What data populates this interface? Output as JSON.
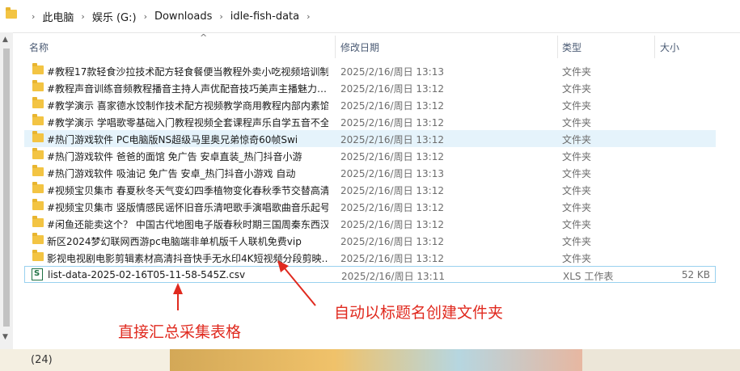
{
  "breadcrumb": [
    "此电脑",
    "娱乐 (G:)",
    "Downloads",
    "idle-fish-data"
  ],
  "columns": {
    "name": "名称",
    "modified": "修改日期",
    "type": "类型",
    "size": "大小"
  },
  "rows": [
    {
      "name": "#教程17款轻食沙拉技术配方轻食餐便当教程外卖小吃视频培训制",
      "date": "2025/2/16/周日 13:13",
      "type": "文件夹",
      "size": ""
    },
    {
      "name": "#教程声音训练音频教程播音主持人声优配音技巧美声主播魅力…",
      "date": "2025/2/16/周日 13:12",
      "type": "文件夹",
      "size": ""
    },
    {
      "name": "#教学演示 喜家德水饺制作技术配方视频教学商用教程内部内素馅",
      "date": "2025/2/16/周日 13:12",
      "type": "文件夹",
      "size": ""
    },
    {
      "name": "#教学演示 学唱歌零基础入门教程视频全套课程声乐自学五音不全",
      "date": "2025/2/16/周日 13:12",
      "type": "文件夹",
      "size": ""
    },
    {
      "name": "#热门游戏软件 PC电脑版NS超级马里奥兄弟惊奇60帧Swi",
      "date": "2025/2/16/周日 13:12",
      "type": "文件夹",
      "size": ""
    },
    {
      "name": "#热门游戏软件 爸爸的面馆  免广告 安卓直装_热门抖音小游",
      "date": "2025/2/16/周日 13:12",
      "type": "文件夹",
      "size": ""
    },
    {
      "name": "#热门游戏软件 吸油记 免广告 安卓_热门抖音小游戏  自动",
      "date": "2025/2/16/周日 13:13",
      "type": "文件夹",
      "size": ""
    },
    {
      "name": "#视频宝贝集市 春夏秋冬天气变幻四季植物变化春秋季节交替高清",
      "date": "2025/2/16/周日 13:12",
      "type": "文件夹",
      "size": ""
    },
    {
      "name": "#视频宝贝集市 竖版情感民谣怀旧音乐清吧歌手演唱歌曲音乐起号",
      "date": "2025/2/16/周日 13:12",
      "type": "文件夹",
      "size": ""
    },
    {
      "name": "#闲鱼还能卖这个？ 中国古代地图电子版春秋时期三国周秦东西汉",
      "date": "2025/2/16/周日 13:12",
      "type": "文件夹",
      "size": ""
    },
    {
      "name": "新区2024梦幻联网西游pc电脑端非单机版千人联机免费vip",
      "date": "2025/2/16/周日 13:12",
      "type": "文件夹",
      "size": ""
    },
    {
      "name": "影视电视剧电影剪辑素材高清抖音快手无水印4K短视频分段剪映…",
      "date": "2025/2/16/周日 13:12",
      "type": "文件夹",
      "size": ""
    },
    {
      "name": "list-data-2025-02-16T05-11-58-545Z.csv",
      "date": "2025/2/16/周日 13:11",
      "type": "XLS 工作表",
      "size": "52 KB"
    }
  ],
  "annotations": {
    "left": "直接汇总采集表格",
    "right": "自动以标题名创建文件夹"
  },
  "bottom_text": "(24)",
  "colors": {
    "annotation": "#e02a1f",
    "folder": "#f3c443",
    "hover_row": "#e5f3fb"
  }
}
